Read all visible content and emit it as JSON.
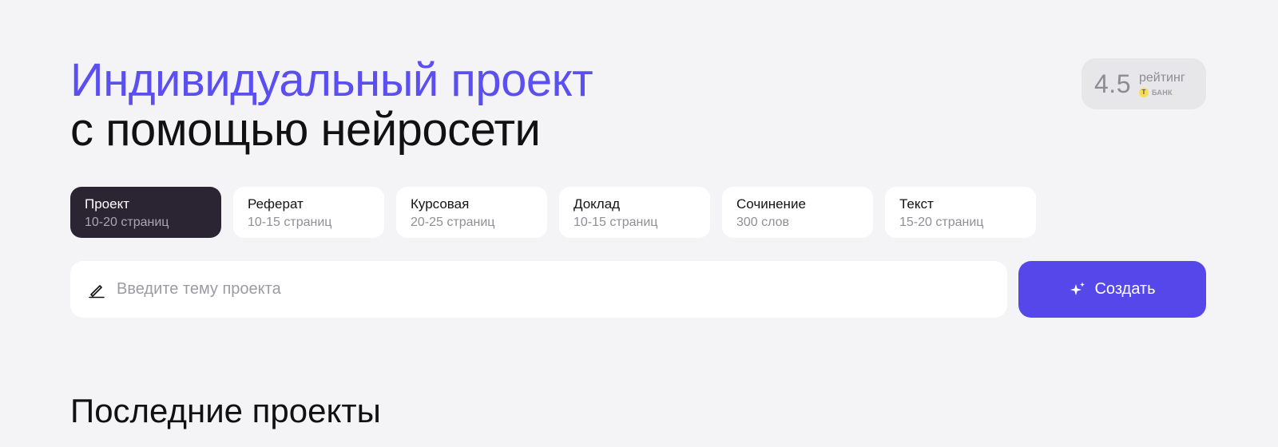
{
  "hero": {
    "title_accent": "Индивидуальный проект",
    "title_rest": "с помощью нейросети"
  },
  "rating": {
    "value": "4.5",
    "label": "рейтинг",
    "brand_icon_letter": "Т",
    "brand": "БАНК"
  },
  "types": [
    {
      "name": "Проект",
      "desc": "10-20 страниц",
      "active": true
    },
    {
      "name": "Реферат",
      "desc": "10-15 страниц",
      "active": false
    },
    {
      "name": "Курсовая",
      "desc": "20-25 страниц",
      "active": false
    },
    {
      "name": "Доклад",
      "desc": "10-15 страниц",
      "active": false
    },
    {
      "name": "Сочинение",
      "desc": "300 слов",
      "active": false
    },
    {
      "name": "Текст",
      "desc": "15-20 страниц",
      "active": false
    }
  ],
  "topic": {
    "placeholder": "Введите тему проекта",
    "value": "",
    "icon": "pencil-icon"
  },
  "create": {
    "label": "Создать",
    "icon": "sparkle-icon"
  },
  "recent": {
    "title": "Последние проекты"
  },
  "colors": {
    "accent": "#5b4ff0",
    "button": "#5547ea",
    "active_card": "#2a2433",
    "background": "#f4f4f7"
  }
}
